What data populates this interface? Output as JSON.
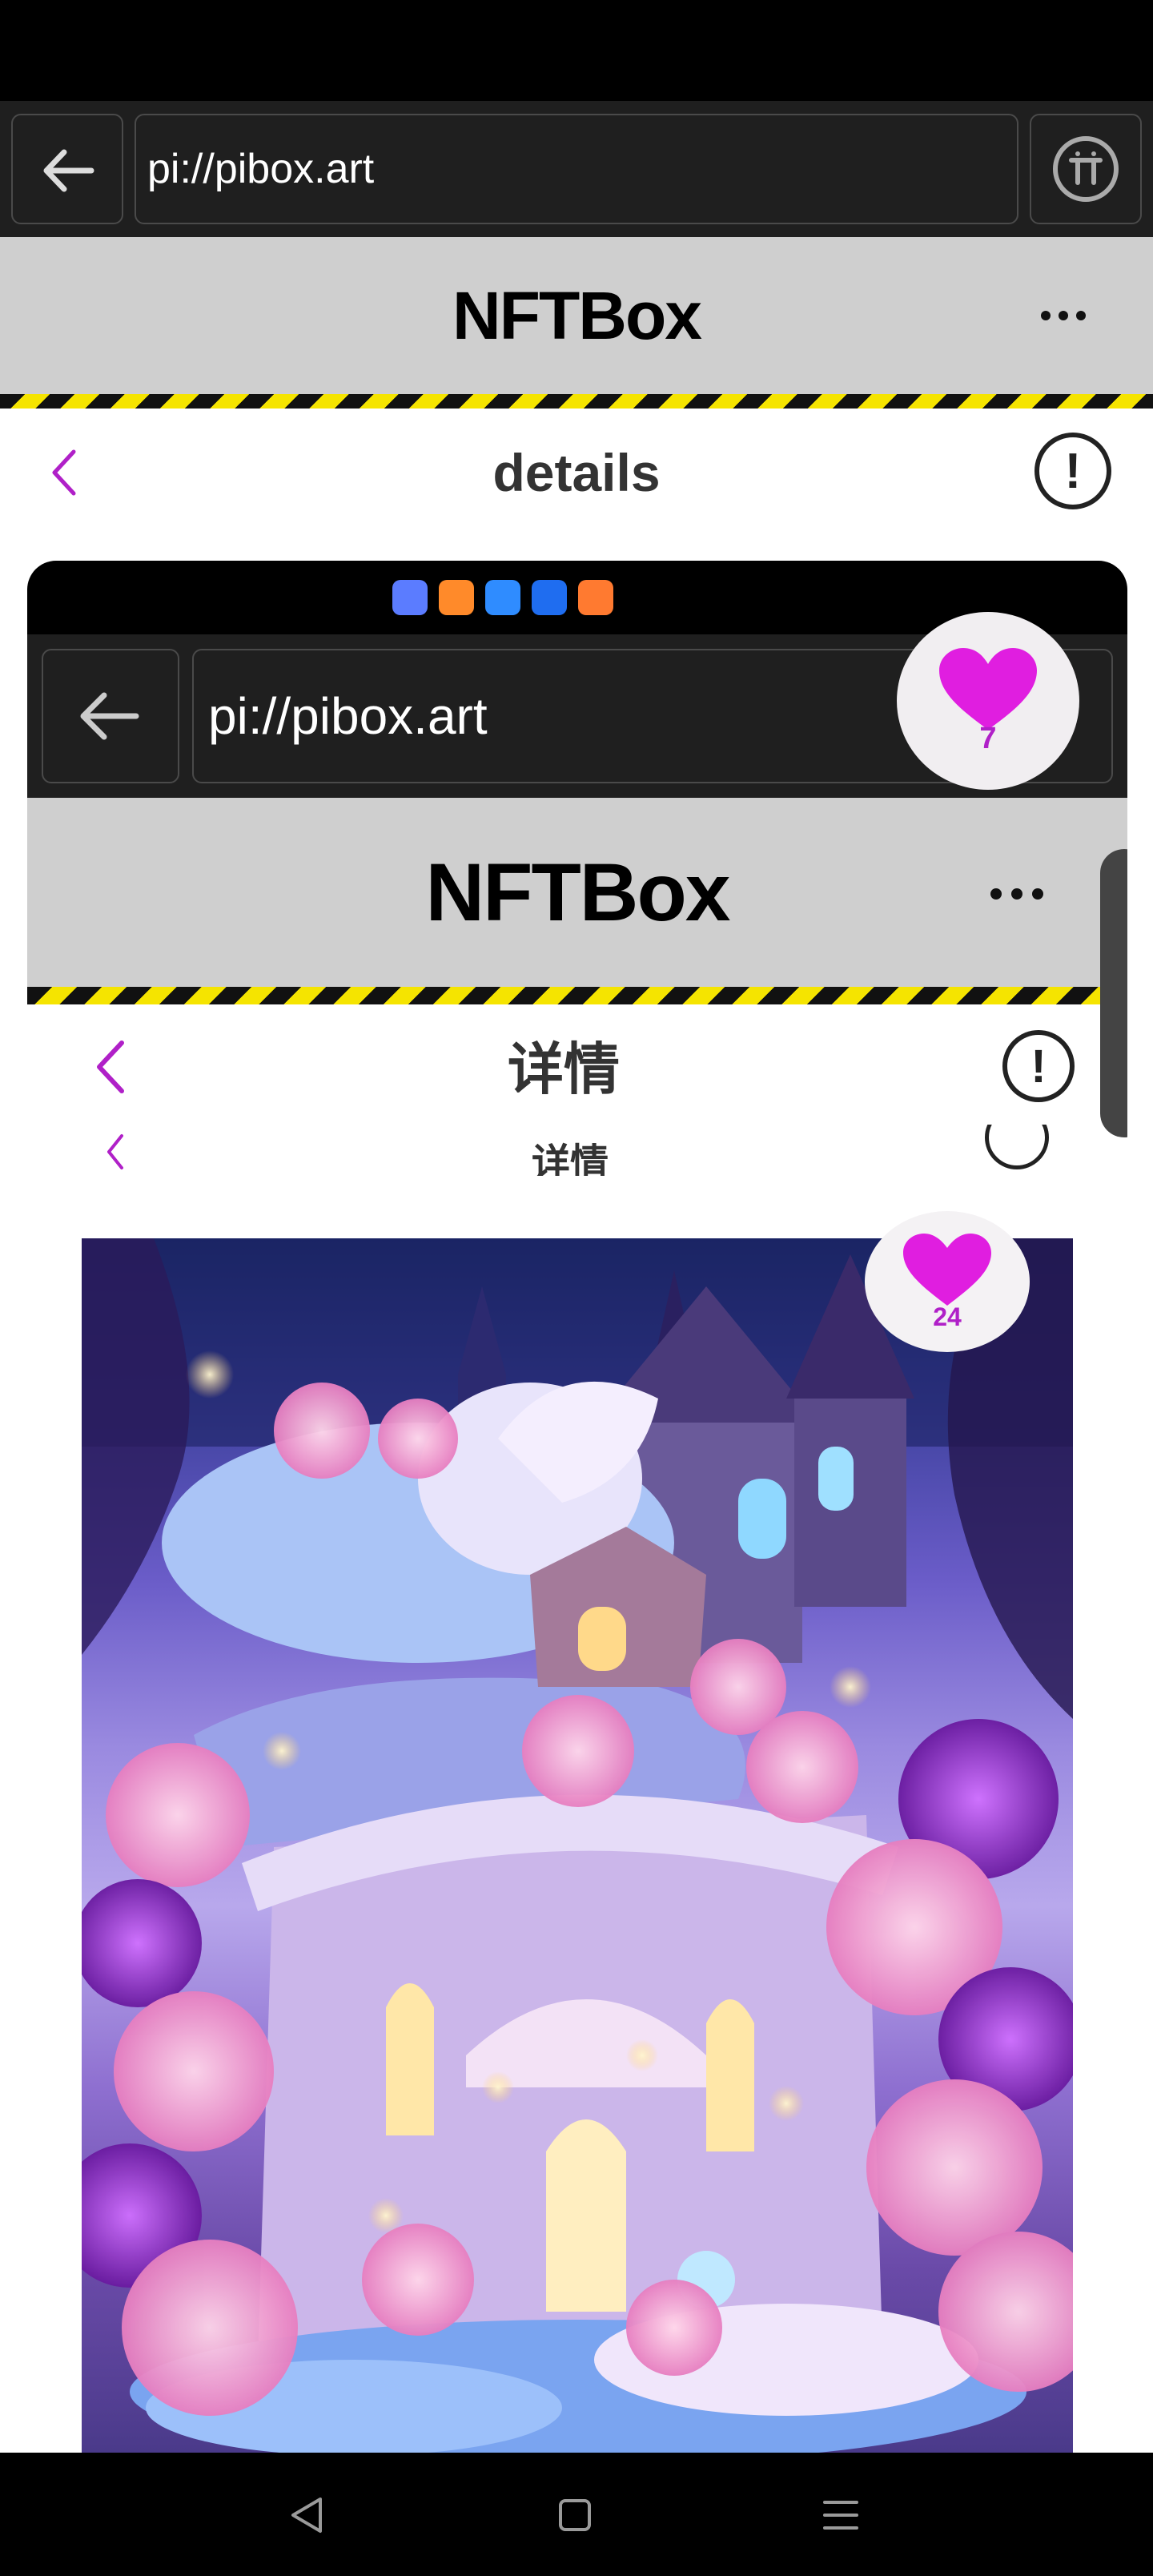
{
  "browser": {
    "url": "pi://pibox.art",
    "back_icon": "arrow-left-icon",
    "pi_icon": "pi-logo-icon"
  },
  "app": {
    "title": "NFTBox",
    "more_icon": "more-dots-icon"
  },
  "page": {
    "title": "details",
    "back_icon": "chevron-left-icon",
    "info_icon": "info-exclamation-icon"
  },
  "embedded": {
    "url": "pi://pibox.art",
    "app_title": "NFTBox",
    "page_title": "详情",
    "page_title_partial": "详情",
    "heart_count_outer": "7",
    "heart_count_image": "24",
    "app_icons": [
      "music-app-icon",
      "video-app-icon",
      "cloud-app-icon",
      "bulb-app-icon",
      "game-app-icon"
    ]
  },
  "colors": {
    "accent_purple": "#b020c8",
    "heart_magenta": "#e01ee0",
    "hazard_yellow": "#f5e400",
    "header_gray": "#cfcfcf"
  },
  "image": {
    "subject": "fantasy castle artwork"
  }
}
